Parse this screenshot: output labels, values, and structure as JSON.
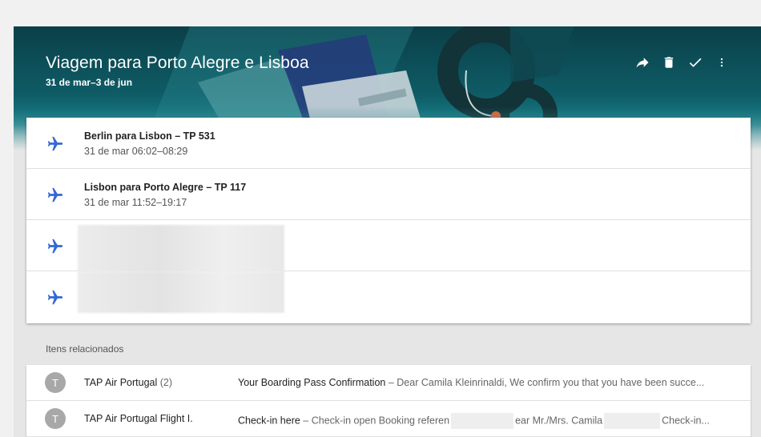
{
  "trip": {
    "title": "Viagem para Porto Alegre e Lisboa",
    "dates": "31 de mar–3 de jun"
  },
  "actions": [
    {
      "name": "share-icon",
      "label": "Compartilhar"
    },
    {
      "name": "trash-icon",
      "label": "Excluir"
    },
    {
      "name": "check-icon",
      "label": "Concluído"
    },
    {
      "name": "more-vert-icon",
      "label": "Mais"
    }
  ],
  "flights": [
    {
      "name": "Berlin para Lisbon – TP 531",
      "time": "31 de mar 06:02–08:29",
      "icon": "airplane-icon"
    },
    {
      "name": "Lisbon para Porto Alegre – TP 117",
      "time": "31 de mar 11:52–19:17",
      "icon": "airplane-icon"
    },
    {
      "name": "",
      "time": "",
      "icon": "airplane-icon",
      "redacted": true
    },
    {
      "name": "",
      "time": "",
      "icon": "airplane-icon",
      "redacted": true
    }
  ],
  "related": {
    "label": "Itens relacionados",
    "emails": [
      {
        "avatar": "T",
        "sender": "TAP Air Portugal",
        "count": "(2)",
        "subject": "Your Boarding Pass Confirmation",
        "snippet": " – Dear Camila Kleinrinaldi, We confirm you that you have been succe..."
      },
      {
        "avatar": "T",
        "sender": "TAP Air Portugal Flight I.",
        "count": "",
        "subject": "Check-in here",
        "snippet_a": " – Check-in open Booking referen",
        "snippet_b": "ear Mr./Mrs. Camila",
        "snippet_c": "Check-in..."
      }
    ]
  },
  "colors": {
    "accent_icon": "#3367d6",
    "hero_teal": "#0e5c66"
  }
}
